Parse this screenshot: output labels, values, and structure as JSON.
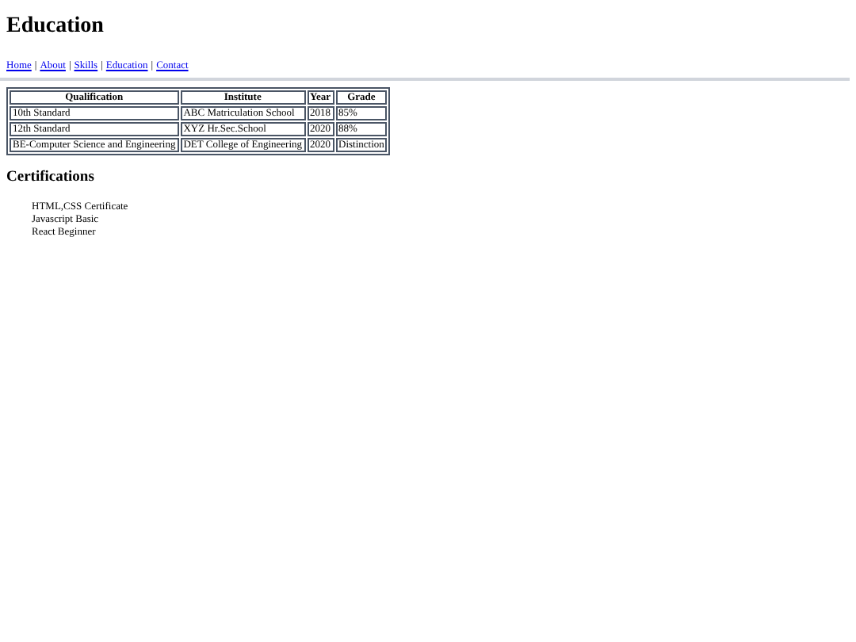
{
  "title": "Education",
  "nav": [
    {
      "kind": "link",
      "label": "Home"
    },
    {
      "kind": "separator",
      "label": "|"
    },
    {
      "kind": "link",
      "label": "About"
    },
    {
      "kind": "separator",
      "label": "|"
    },
    {
      "kind": "link",
      "label": "Skills"
    },
    {
      "kind": "separator",
      "label": "|"
    },
    {
      "kind": "link",
      "label": "Education"
    },
    {
      "kind": "separator",
      "label": "|"
    },
    {
      "kind": "link",
      "label": "Contact"
    }
  ],
  "table": {
    "columns": [
      "Qualification",
      "Institute",
      "Year",
      "Grade"
    ],
    "rows": [
      [
        "10th Standard",
        "ABC Matriculation School",
        "2018",
        "85%"
      ],
      [
        "12th Standard",
        "XYZ Hr.Sec.School",
        "2020",
        "88%"
      ],
      [
        "BE-Computer Science and Engineering",
        "DET College of Engineering",
        "2020",
        "Distinction"
      ]
    ]
  },
  "certifications": {
    "heading": "Certifications",
    "items": [
      "HTML,CSS Certificate",
      "Javascript Basic",
      "React Beginner"
    ]
  }
}
